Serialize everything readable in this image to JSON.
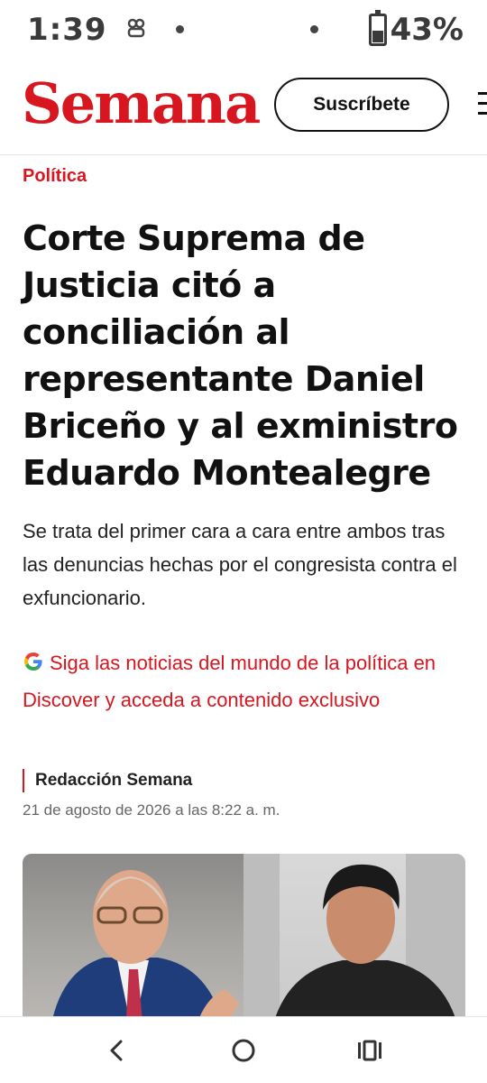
{
  "status_bar": {
    "time": "1:39",
    "battery_percent": "43%",
    "battery_level": 0.43,
    "icons": [
      "media-icon",
      "notification-dot",
      "signal-dot",
      "battery-icon"
    ]
  },
  "header": {
    "logo_text": "Semana",
    "subscribe_label": "Suscríbete",
    "brand_color": "#d7161f"
  },
  "article": {
    "section": "Política",
    "headline": "Corte Suprema de Justicia citó a conciliación al representante Daniel Briceño y al exministro Eduardo Montealegre",
    "lead": "Se trata del primer cara a cara entre ambos tras las denuncias hechas por el congresista contra el exfuncionario.",
    "discover_text": "Siga las noticias del mundo de la política en Discover y acceda a contenido exclusivo",
    "author": "Redacción Semana",
    "date": "21 de agosto de 2026 a las 8:22 a. m."
  },
  "nav": {
    "buttons": [
      "back-icon",
      "home-icon",
      "recents-icon"
    ]
  }
}
